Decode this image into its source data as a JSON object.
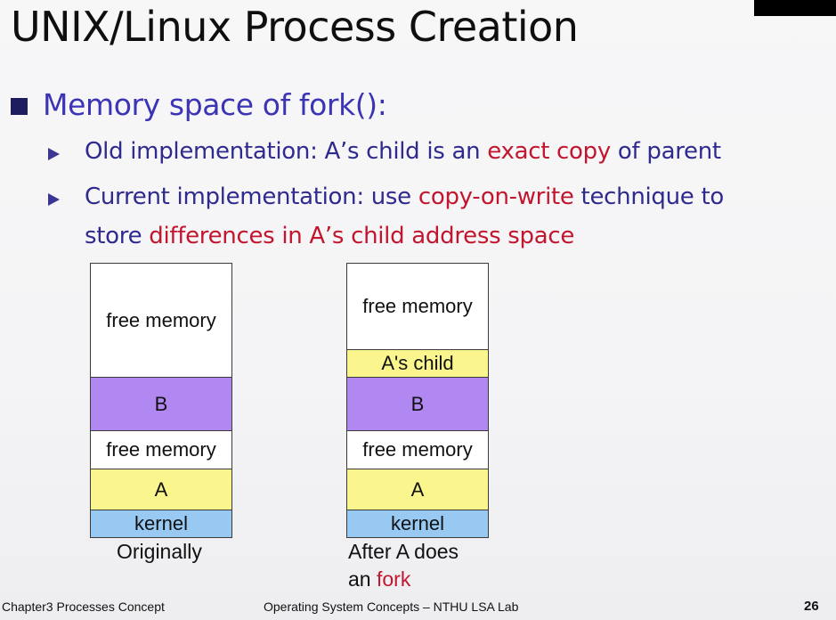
{
  "slide": {
    "title": "UNIX/Linux Process Creation",
    "bullet": "Memory space of fork():",
    "sub1": {
      "pre": "Old implementation: A’s child is an ",
      "red": "exact copy",
      "post": " of parent"
    },
    "sub2": {
      "pre": "Current implementation: use ",
      "red": "copy-on-write",
      "post": " technique to",
      "line2_pre": "store ",
      "line2_red": "differences in A’s child address space"
    }
  },
  "diagram": {
    "left": {
      "segments": [
        "free memory",
        "B",
        "free memory",
        "A",
        "kernel"
      ],
      "caption": "Originally"
    },
    "right": {
      "segments": [
        "free memory",
        "A's child",
        "B",
        "free memory",
        "A",
        "kernel"
      ],
      "caption_line1": "After A does",
      "caption_line2_pre": "an ",
      "caption_line2_red": "fork"
    }
  },
  "footer": {
    "left": "Chapter3 Processes Concept",
    "center": "Operating System Concepts – NTHU LSA Lab",
    "page": "26"
  },
  "colors": {
    "title": "#0f0f0f",
    "bullet_text": "#3b34b4",
    "highlight": "#c2162f",
    "segment_b": "#b187f2",
    "segment_a": "#fbf58e",
    "segment_kernel": "#97c9f3"
  }
}
